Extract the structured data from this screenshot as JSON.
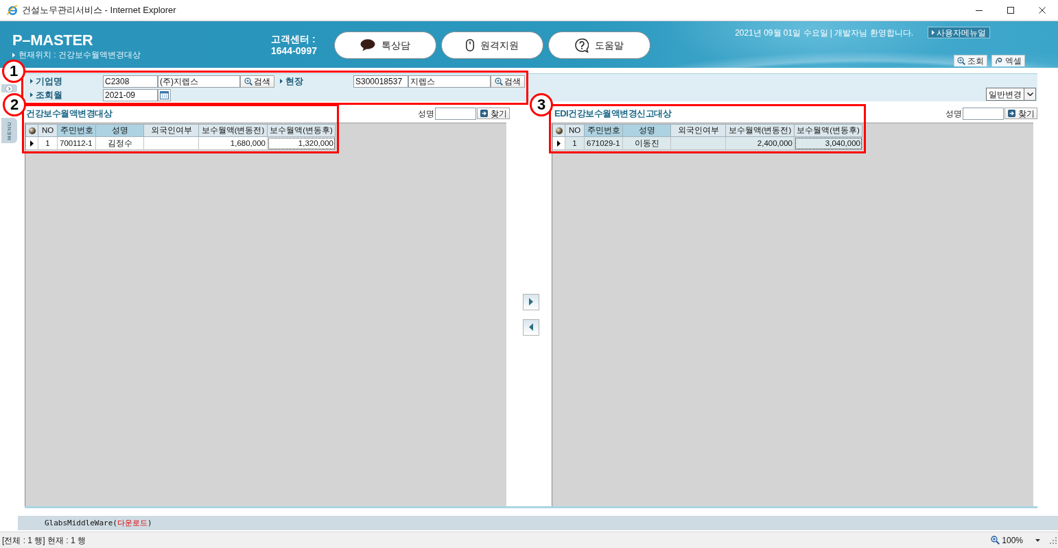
{
  "window": {
    "title": "건설노무관리서비스 - Internet Explorer"
  },
  "header": {
    "logo": "P–MASTER",
    "location": "현재위치 : 건강보수월액변경대상",
    "support_label": "고객센터 :",
    "support_phone": "1644-0997",
    "buttons": [
      {
        "label": "톡상담",
        "kind": "chat"
      },
      {
        "label": "원격지원",
        "kind": "mouse"
      },
      {
        "label": "도움말",
        "kind": "help"
      }
    ],
    "greeting": "2021년 09월 01일 수요일 | 개발자님 환영합니다.",
    "manual_button": "사용자메뉴얼",
    "tabs": [
      {
        "label": "조회",
        "kind": "zoom"
      },
      {
        "label": "엑셀",
        "kind": "swirl"
      }
    ]
  },
  "side_menu": {
    "label": "MENU"
  },
  "search": {
    "callout": "1",
    "company": {
      "label": "기업명",
      "code": "C2308",
      "name": "(주)지렙스",
      "button": "검색"
    },
    "site": {
      "label": "현장",
      "code": "S300018537",
      "name": "지렙스",
      "button": "검색"
    },
    "month": {
      "label": "조회월",
      "value": "2021-09"
    }
  },
  "change_type": {
    "value": "일반변경"
  },
  "panels": [
    {
      "title": "건강보수월액변경대상",
      "callout": "2",
      "search_label": "성명",
      "find_button": "찾기",
      "columns": [
        {
          "label": "NO",
          "highlighted": false
        },
        {
          "label": "주민번호",
          "highlighted": true
        },
        {
          "label": "성명",
          "highlighted": true
        },
        {
          "label": "외국인여부",
          "highlighted": false
        },
        {
          "label": "보수월액(변동전)",
          "highlighted": false
        },
        {
          "label": "보수월액(변동후)",
          "highlighted": false
        }
      ],
      "rows": [
        {
          "current": true,
          "selected": false,
          "cells": [
            "1",
            "700112-1",
            "김정수",
            null,
            "1,680,000",
            "1,320,000"
          ]
        }
      ]
    },
    {
      "title": "EDI건강보수월액변경신고대상",
      "callout": "3",
      "search_label": "성명",
      "find_button": "찾기",
      "columns": [
        {
          "label": "NO",
          "highlighted": false
        },
        {
          "label": "주민번호",
          "highlighted": true
        },
        {
          "label": "성명",
          "highlighted": true
        },
        {
          "label": "외국인여부",
          "highlighted": false
        },
        {
          "label": "보수월액(변동전)",
          "highlighted": false
        },
        {
          "label": "보수월액(변동후)",
          "highlighted": false
        }
      ],
      "rows": [
        {
          "current": true,
          "selected": true,
          "cells": [
            "1",
            "671029-1",
            "이동진",
            null,
            "2,400,000",
            "3,040,000"
          ]
        }
      ]
    }
  ],
  "transfer_buttons": [
    {
      "kind": "right"
    },
    {
      "kind": "left"
    }
  ],
  "footer": {
    "text_before": "GlabsMiddleWare(",
    "link": "다운로드",
    "text_after": ")"
  },
  "status_bar": {
    "text": "[전체 : 1 행] 현재 : 1 행",
    "zoom": "100%"
  }
}
